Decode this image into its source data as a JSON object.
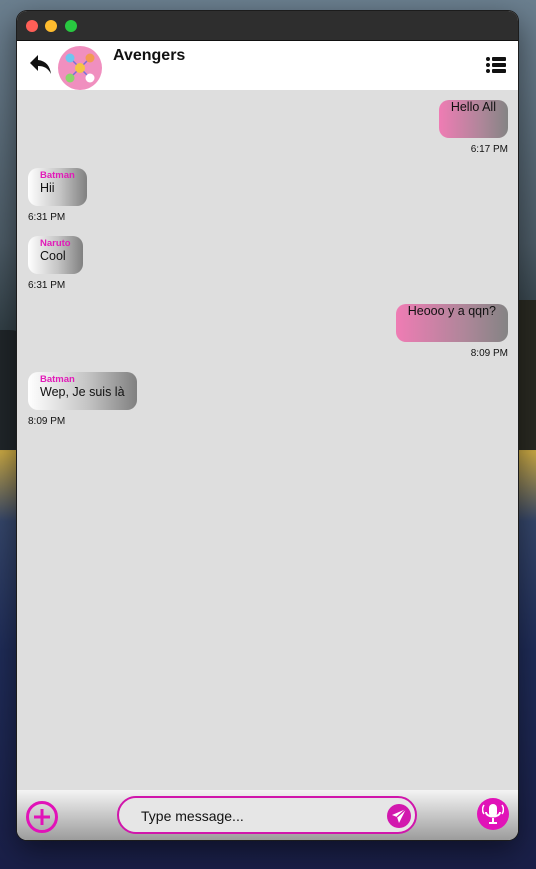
{
  "window": {
    "controls": [
      "close",
      "minimize",
      "maximize"
    ]
  },
  "header": {
    "title": "Avengers",
    "back_icon": "back-arrow-icon",
    "menu_icon": "list-menu-icon",
    "avatar_icon": "group-avatar-icon"
  },
  "messages": [
    {
      "direction": "out",
      "sender": "",
      "text": "Hello All",
      "time": "6:17 PM"
    },
    {
      "direction": "in",
      "sender": "Batman",
      "text": "Hii",
      "time": "6:31 PM"
    },
    {
      "direction": "in",
      "sender": "Naruto",
      "text": "Cool",
      "time": "6:31 PM"
    },
    {
      "direction": "out",
      "sender": "",
      "text": "Heooo y a qqn?",
      "time": "8:09 PM"
    },
    {
      "direction": "in",
      "sender": "Batman",
      "text": "Wep, Je suis là",
      "time": "8:09 PM"
    }
  ],
  "composer": {
    "placeholder": "Type message...",
    "value": "",
    "add_icon": "plus-circle-icon",
    "send_icon": "paper-plane-icon",
    "mic_icon": "microphone-icon"
  },
  "colors": {
    "accent": "#e112b8",
    "sender_name": "#e11bb8",
    "outgoing_bubble": "#ef7cb4",
    "chat_background": "#dedede"
  }
}
